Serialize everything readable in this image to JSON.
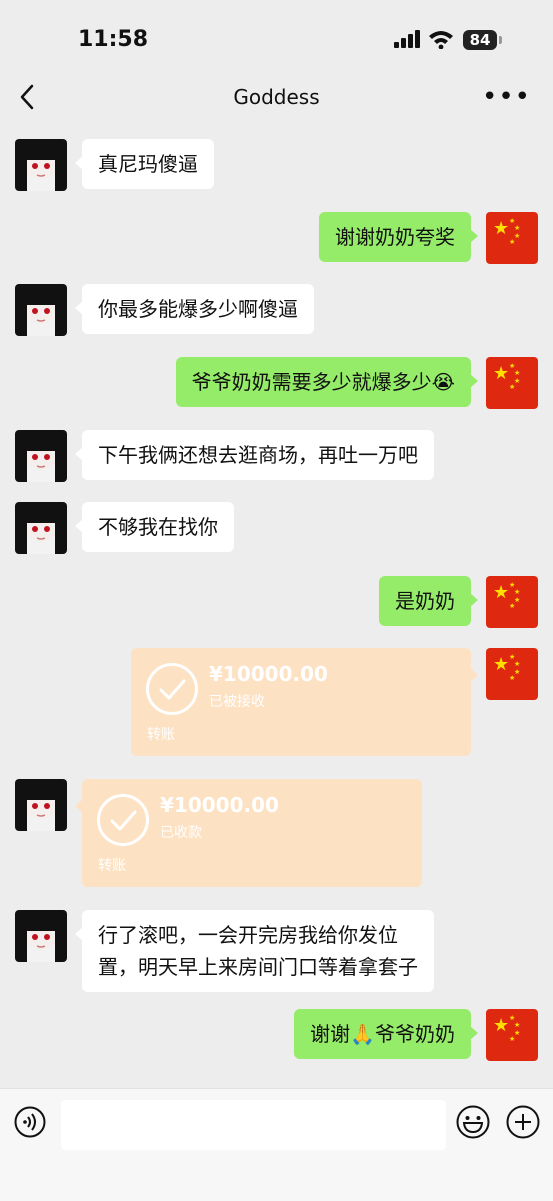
{
  "status_bar": {
    "time": "11:58",
    "battery": "84"
  },
  "header": {
    "title": "Goddess",
    "more_icon": "more-dots-icon"
  },
  "messages": [
    {
      "side": "in",
      "type": "text",
      "text": "真尼玛傻逼"
    },
    {
      "side": "out",
      "type": "text",
      "text": "谢谢奶奶夸奖"
    },
    {
      "side": "in",
      "type": "text",
      "text": "你最多能爆多少啊傻逼"
    },
    {
      "side": "out",
      "type": "text",
      "text": "爷爷奶奶需要多少就爆多少😭"
    },
    {
      "side": "in",
      "type": "text",
      "text": "下午我俩还想去逛商场，再吐一万吧"
    },
    {
      "side": "in",
      "type": "text",
      "text": "不够我在找你"
    },
    {
      "side": "out",
      "type": "text",
      "text": "是奶奶"
    },
    {
      "side": "out",
      "type": "transfer",
      "amount": "¥10000.00",
      "status": "已被接收",
      "label": "转账"
    },
    {
      "side": "in",
      "type": "transfer",
      "amount": "¥10000.00",
      "status": "已收款",
      "label": "转账"
    },
    {
      "side": "in",
      "type": "text",
      "text": "行了滚吧，一会开完房我给你发位置，明天早上来房间门口等着拿套子",
      "line1": "行了滚吧，一会开完房我给你发位",
      "line2": "置，明天早上来房间门口等着拿套子"
    },
    {
      "side": "out",
      "type": "text",
      "text": "谢谢🙏爷爷奶奶"
    }
  ],
  "colors": {
    "background": "#ededed",
    "incoming_bubble": "#ffffff",
    "outgoing_bubble": "#95ec69",
    "transfer_card": "#fde1c3",
    "flag_red": "#de2910",
    "flag_yellow": "#ffde00"
  },
  "input_bar": {
    "voice_icon": "voice-icon",
    "emoji_icon": "emoji-icon",
    "plus_icon": "plus-icon",
    "input_value": ""
  }
}
